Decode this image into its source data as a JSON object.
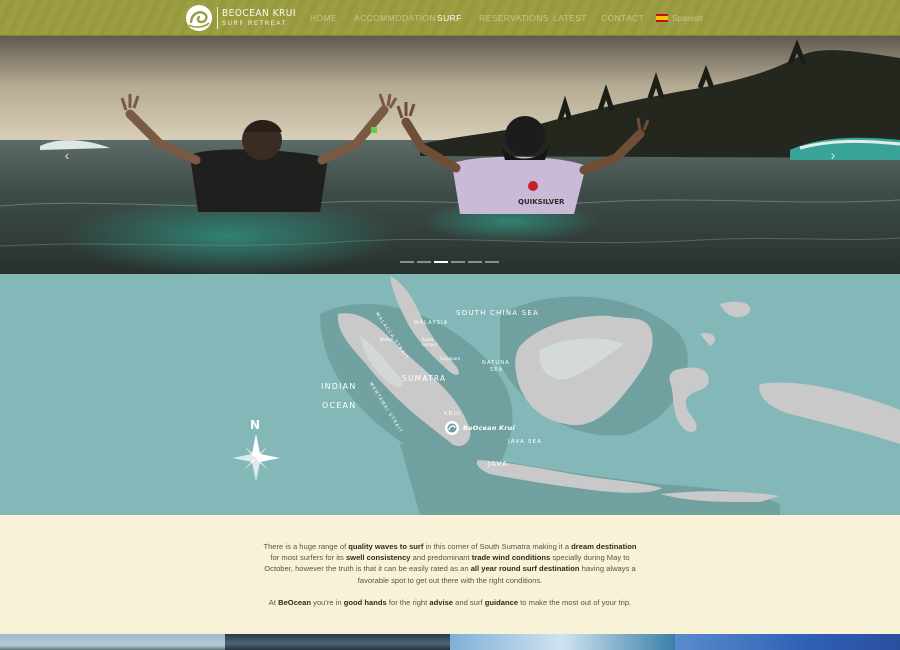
{
  "brand": {
    "name": "BEOCEAN KRUI",
    "tagline": "SURF RETREAT"
  },
  "nav": {
    "items": [
      {
        "label": "HOME",
        "active": false
      },
      {
        "label": "ACCOMMODATION",
        "active": false
      },
      {
        "label": "SURF",
        "active": true
      },
      {
        "label": "RESERVATIONS",
        "active": false
      },
      {
        "label": "LATEST",
        "active": false
      },
      {
        "label": "CONTACT",
        "active": false
      }
    ],
    "language": {
      "label": "Spanish",
      "icon": "spain-flag-icon"
    }
  },
  "slider": {
    "slides": 6,
    "active_slide": 3,
    "prev_icon": "chevron-left-icon",
    "next_icon": "chevron-right-icon",
    "shirt_text": "QUIKSILVER"
  },
  "map": {
    "labels": {
      "south_china_sea": "SOUTH CHINA SEA",
      "malacca_strait": "MALACCA STRAIT",
      "malaysia": "MALAYSIA",
      "medan": "Medan",
      "kuala_lumpur": "Kuala Lumpur",
      "singapore": "Singapore",
      "natuna_sea_1": "NATUNA",
      "natuna_sea_2": "SEA",
      "sumatra": "SUMATRA",
      "indian_1": "INDIAN",
      "indian_2": "OCEAN",
      "mentawai_strait": "MENTAWAI STRAIT",
      "krui": "KRUI",
      "pin": "BeOcean Krui",
      "java_sea": "JAVA SEA",
      "java": "JAVA",
      "north": "N"
    },
    "colors": {
      "sea": "#84b8b8",
      "land": "#c9c9c9",
      "shelf": "#6e9c9c"
    }
  },
  "content": {
    "p1": [
      {
        "t": "There is a huge range of ",
        "b": false
      },
      {
        "t": "quality waves to surf",
        "b": true
      },
      {
        "t": " in this corner of South Sumatra making it a ",
        "b": false
      },
      {
        "t": "dream destination",
        "b": true
      },
      {
        "t": " for most surfers for its ",
        "b": false
      },
      {
        "t": "swell consistency",
        "b": true
      },
      {
        "t": " and predominant ",
        "b": false
      },
      {
        "t": "trade wind conditions",
        "b": true
      },
      {
        "t": " specially during May to October, however the truth is that it can be easily rated as an ",
        "b": false
      },
      {
        "t": "all year round surf destination",
        "b": true
      },
      {
        "t": " having always a favorable spot to get out there with the right conditions.",
        "b": false
      }
    ],
    "p2": [
      {
        "t": "At ",
        "b": false
      },
      {
        "t": "BeOcean",
        "b": true
      },
      {
        "t": " you're in ",
        "b": false
      },
      {
        "t": "good hands",
        "b": true
      },
      {
        "t": " for the right ",
        "b": false
      },
      {
        "t": "advise",
        "b": true
      },
      {
        "t": " and surf ",
        "b": false
      },
      {
        "t": "guidance",
        "b": true
      },
      {
        "t": " to make the most out of your trip.",
        "b": false
      }
    ]
  },
  "colors": {
    "nav": "#9a9c40",
    "nav_text": "#c5c78e",
    "nav_active": "#ffffff",
    "content_bg": "#f8f3d6",
    "text": "#555548"
  }
}
